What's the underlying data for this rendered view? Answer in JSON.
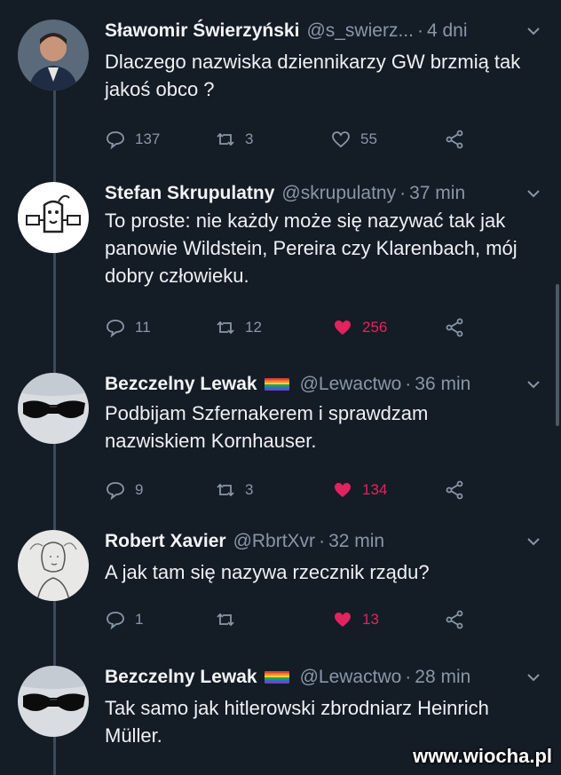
{
  "tweets": [
    {
      "name": "Sławomir Świerzyński",
      "handle": "@s_swierz...",
      "time": "4 dni",
      "text": "Dlaczego nazwiska dziennikarzy GW brzmią tak jakoś obco ?",
      "replies": "137",
      "retweets": "3",
      "likes": "55",
      "liked": false,
      "flag": false
    },
    {
      "name": "Stefan Skrupulatny",
      "handle": "@skrupulatny",
      "time": "37 min",
      "text": "To proste: nie każdy może się nazywać tak jak panowie Wildstein, Pereira czy Klarenbach, mój dobry człowieku.",
      "replies": "11",
      "retweets": "12",
      "likes": "256",
      "liked": true,
      "flag": false
    },
    {
      "name": "Bezczelny Lewak",
      "handle": "@Lewactwo",
      "time": "36 min",
      "text": "Podbijam Szfernakerem i sprawdzam nazwiskiem Kornhauser.",
      "replies": "9",
      "retweets": "3",
      "likes": "134",
      "liked": true,
      "flag": true
    },
    {
      "name": "Robert Xavier",
      "handle": "@RbrtXvr",
      "time": "32 min",
      "text": "A jak tam się nazywa rzecznik rządu?",
      "replies": "1",
      "retweets": "",
      "likes": "13",
      "liked": true,
      "flag": false
    },
    {
      "name": "Bezczelny Lewak",
      "handle": "@Lewactwo",
      "time": "28 min",
      "text": "Tak samo jak hitlerowski zbrodniarz Heinrich Müller.",
      "liked": false,
      "flag": true
    }
  ],
  "watermark": "www.wiocha.pl",
  "colors": {
    "background": "#141c26",
    "like": "#e0245e",
    "muted": "#8897a6"
  }
}
